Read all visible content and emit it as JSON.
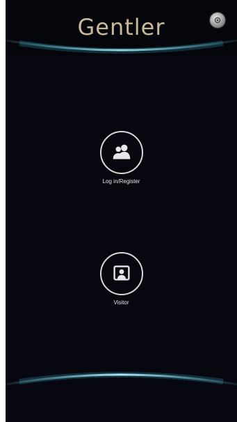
{
  "header": {
    "brand": "Gentler"
  },
  "actions": {
    "login_label": "Log in/Register",
    "visitor_label": "Visitor"
  },
  "colors": {
    "background": "#07080f",
    "brand": "#c9b89a",
    "accent_glow": "#6fd3e6",
    "icon": "#e6e6e6"
  },
  "icons": {
    "settings": "gear-icon",
    "login": "users-icon",
    "visitor": "visitor-icon"
  }
}
